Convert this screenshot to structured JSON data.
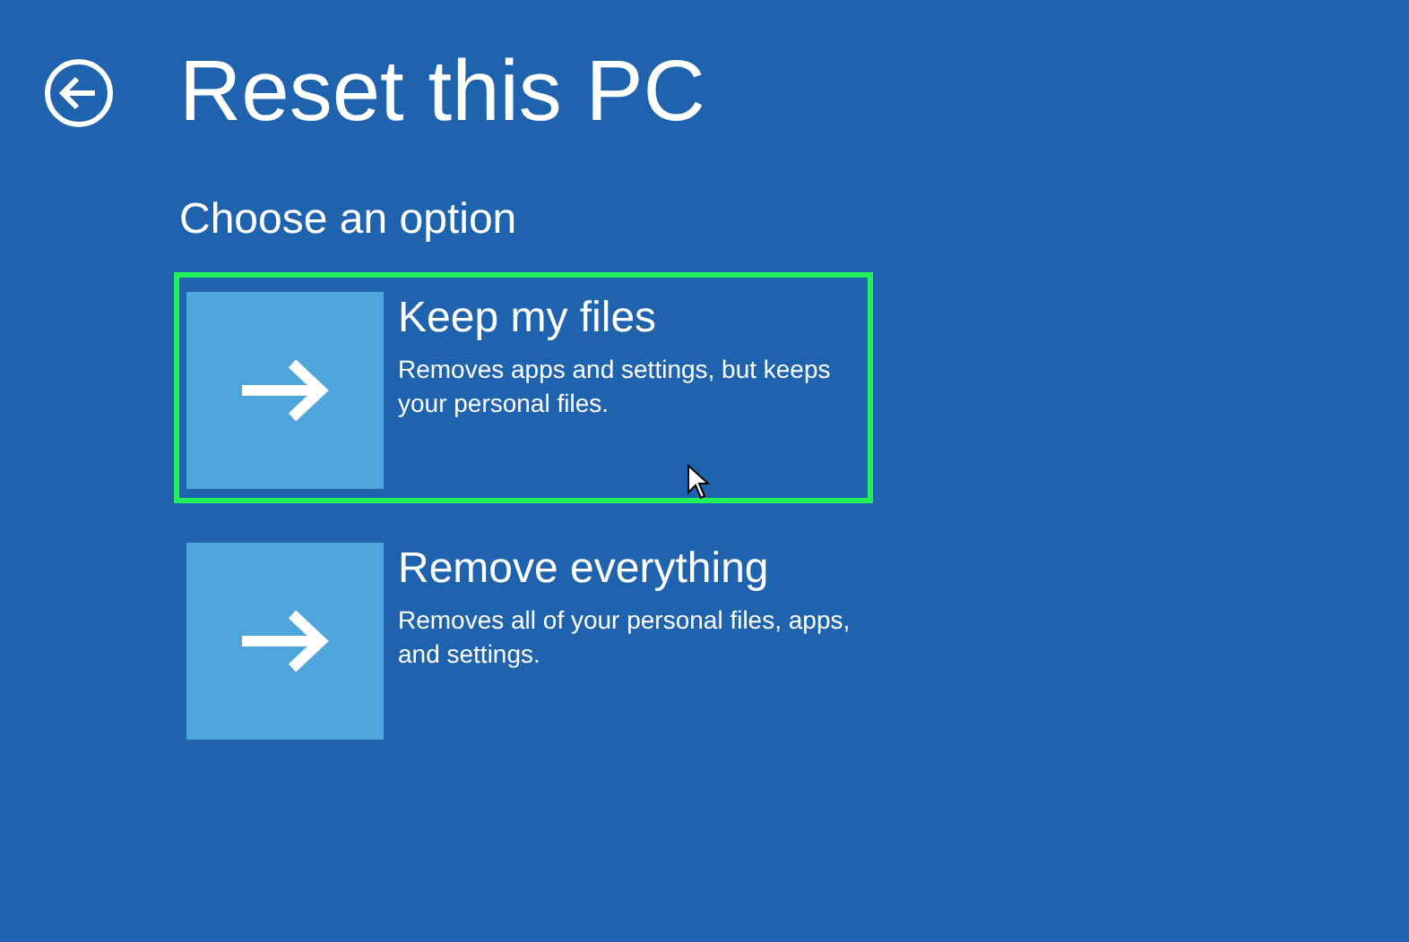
{
  "title": "Reset this PC",
  "subtitle": "Choose an option",
  "options": [
    {
      "title": "Keep my files",
      "description": "Removes apps and settings, but keeps your personal files.",
      "selected": true
    },
    {
      "title": "Remove everything",
      "description": "Removes all of your personal files, apps, and settings.",
      "selected": false
    }
  ]
}
